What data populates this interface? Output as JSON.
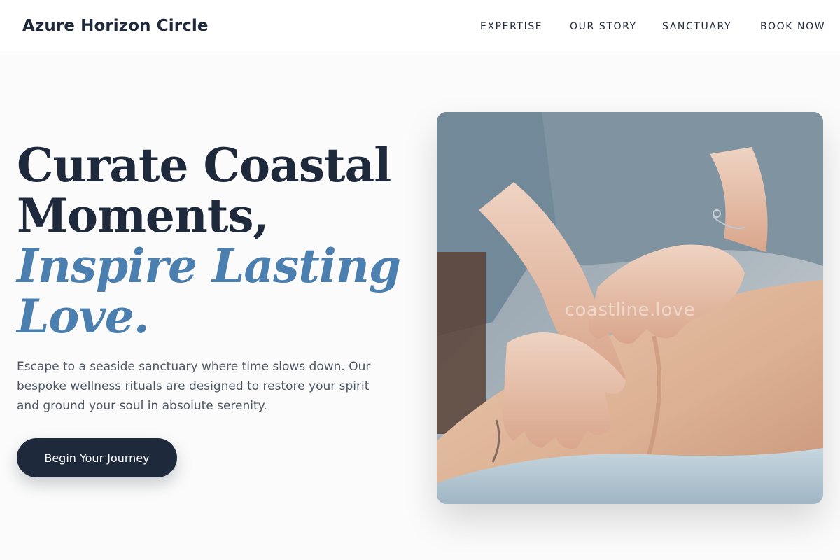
{
  "header": {
    "brand": "Azure Horizon Circle",
    "nav": [
      {
        "label": "EXPERTISE"
      },
      {
        "label": "OUR STORY"
      },
      {
        "label": "SANCTUARY"
      },
      {
        "label": "BOOK NOW"
      }
    ]
  },
  "hero": {
    "headline_line1": "Curate Coastal",
    "headline_line2": "Moments,",
    "headline_accent_line1": "Inspire Lasting",
    "headline_accent_line2": "Love.",
    "lead": "Escape to a seaside sanctuary where time slows down. Our bespoke wellness rituals are designed to restore your spirit and ground your soul in absolute serenity.",
    "cta_label": "Begin Your Journey",
    "image_watermark": "coastline.love"
  },
  "colors": {
    "primary_dark": "#1e293b",
    "accent_blue": "#4a7fb0",
    "body_text": "#4b5563",
    "page_background": "#fbfbfb"
  }
}
